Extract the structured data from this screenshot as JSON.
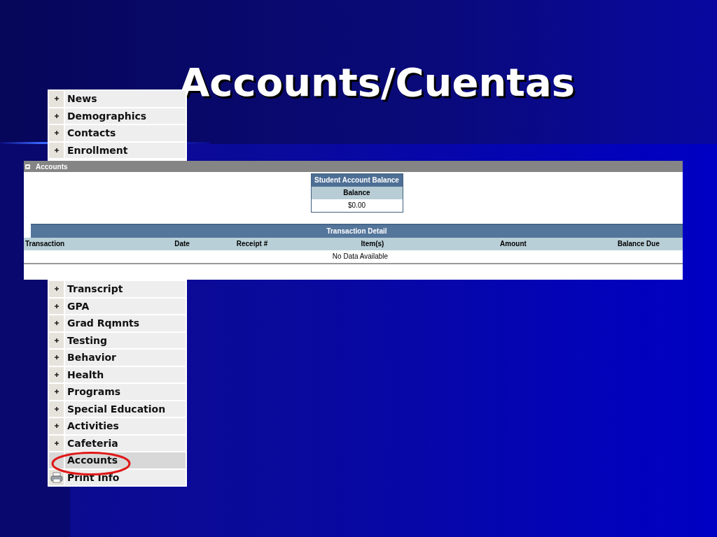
{
  "slide": {
    "title": "Accounts/Cuentas"
  },
  "menu": {
    "items": [
      {
        "label": "News",
        "kind": "section",
        "selected": false
      },
      {
        "label": "Demographics",
        "kind": "section",
        "selected": false
      },
      {
        "label": "Contacts",
        "kind": "section",
        "selected": false
      },
      {
        "label": "Enrollment",
        "kind": "section",
        "selected": false
      },
      {
        "label": "Transcript",
        "kind": "section",
        "selected": false
      },
      {
        "label": "GPA",
        "kind": "section",
        "selected": false
      },
      {
        "label": "Grad Rqmnts",
        "kind": "section",
        "selected": false
      },
      {
        "label": "Testing",
        "kind": "section",
        "selected": false
      },
      {
        "label": "Behavior",
        "kind": "section",
        "selected": false
      },
      {
        "label": "Health",
        "kind": "section",
        "selected": false
      },
      {
        "label": "Programs",
        "kind": "section",
        "selected": false
      },
      {
        "label": "Special Education",
        "kind": "section",
        "selected": false
      },
      {
        "label": "Activities",
        "kind": "section",
        "selected": false
      },
      {
        "label": "Cafeteria",
        "kind": "section",
        "selected": false
      },
      {
        "label": "Accounts",
        "kind": "section",
        "selected": true
      },
      {
        "label": "Print Info",
        "kind": "print",
        "selected": false
      }
    ]
  },
  "panel": {
    "title": "Accounts",
    "expanded": true,
    "balance": {
      "title": "Student Account Balance",
      "column": "Balance",
      "value": "$0.00"
    },
    "transactions": {
      "title": "Transaction Detail",
      "columns": [
        "Transaction",
        "Date",
        "Receipt #",
        "Item(s)",
        "Amount",
        "Balance Due"
      ],
      "empty_message": "No Data Available"
    }
  }
}
